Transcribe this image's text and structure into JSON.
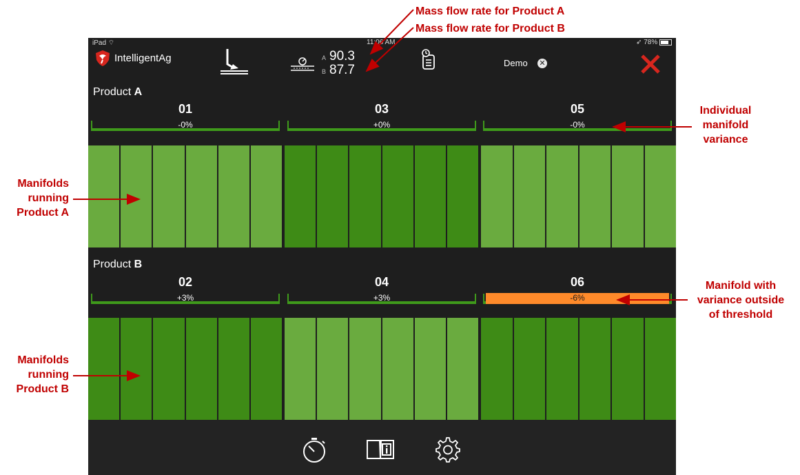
{
  "annotations": {
    "flow_a": "Mass flow rate for Product A",
    "flow_b": "Mass flow rate for Product B",
    "variance": [
      "Individual",
      "manifold",
      "variance"
    ],
    "running_a": [
      "Manifolds",
      "running",
      "Product A"
    ],
    "running_b": [
      "Manifolds",
      "running",
      "Product B"
    ],
    "threshold": [
      "Manifold with",
      "variance outside",
      "of threshold"
    ]
  },
  "status_bar": {
    "device": "iPad",
    "time": "11:06 AM",
    "battery": "78%"
  },
  "header": {
    "brand": "IntelligentAg",
    "flow": {
      "a_letter": "A",
      "a_value": "90.3",
      "b_letter": "B",
      "b_value": "87.7"
    },
    "user": "Demo",
    "icons": [
      "brand-logo-icon",
      "boom-arm-icon",
      "flow-rate-icon",
      "log-report-icon",
      "clear-icon",
      "close-icon"
    ]
  },
  "products": [
    {
      "label": "Product",
      "letter": "A",
      "manifolds": [
        {
          "number": "01",
          "variance": "-0%",
          "alert": false,
          "shade": "light"
        },
        {
          "number": "03",
          "variance": "+0%",
          "alert": false,
          "shade": "dark"
        },
        {
          "number": "05",
          "variance": "-0%",
          "alert": false,
          "shade": "light"
        }
      ]
    },
    {
      "label": "Product",
      "letter": "B",
      "manifolds": [
        {
          "number": "02",
          "variance": "+3%",
          "alert": false,
          "shade": "dark"
        },
        {
          "number": "04",
          "variance": "+3%",
          "alert": false,
          "shade": "light"
        },
        {
          "number": "06",
          "variance": "-6%",
          "alert": true,
          "shade": "dark"
        }
      ]
    }
  ],
  "colors": {
    "light_green": "#6aab3f",
    "dark_green": "#3e8b16",
    "alert_orange": "#ff8a2a",
    "annotation_red": "#c00000",
    "close_red": "#d7261e"
  },
  "bottom_bar": {
    "icons": [
      "stopwatch-icon",
      "manual-info-icon",
      "settings-gear-icon"
    ]
  }
}
